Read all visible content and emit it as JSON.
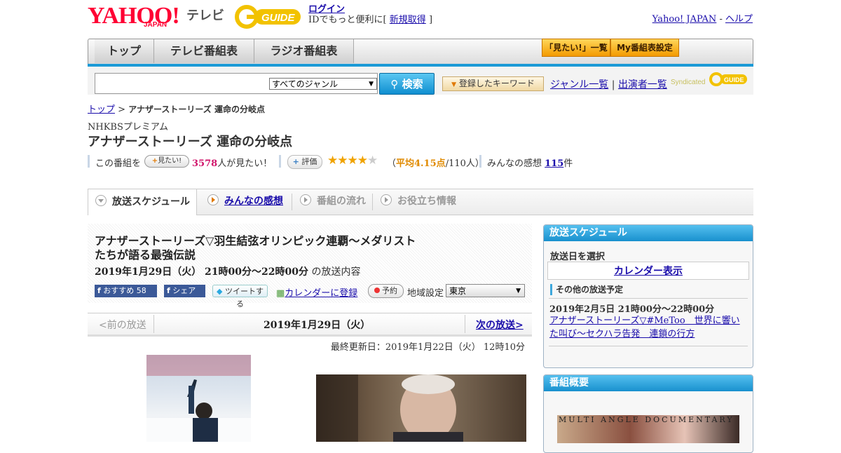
{
  "header": {
    "logo_text": "YAHOO!",
    "logo_sub": "JAPAN",
    "logo_tv": "テレビ",
    "gguide_logo": "GUIDE",
    "login_label": "ログイン",
    "login_sub_prefix": "IDでもっと便利に[",
    "register_label": "新規取得",
    "login_sub_suffix": "]",
    "yahoo_japan_link": "Yahoo! JAPAN",
    "separator": "-",
    "help_link": "ヘルプ"
  },
  "nav": {
    "tabs": [
      "トップ",
      "テレビ番組表",
      "ラジオ番組表"
    ],
    "mitai_list": "「見たい!」一覧",
    "my_schedule": "My番組表設定"
  },
  "search": {
    "genre_selected": "すべてのジャンル",
    "button_label": "検索",
    "keyword_button": "登録したキーワード",
    "genre_list_link": "ジャンル一覧",
    "divider": "|",
    "performer_list_link": "出演者一覧",
    "syndicated": "Syndicated"
  },
  "breadcrumb": {
    "top_link": "トップ",
    "separator": ">",
    "current": "アナザーストーリーズ 運命の分岐点"
  },
  "program": {
    "channel": "NHKBSプレミアム",
    "title": "アナザーストーリーズ 運命の分岐点",
    "watch_prefix": "この番組を",
    "mitai_badge": "見たい!",
    "mitai_count": "3578",
    "mitai_suffix": "人が見たい！",
    "rate_button": "評価",
    "rating": 4.15,
    "rating_stars": "★★★★",
    "rating_star_empty": "★",
    "avg_open": "（",
    "avg_value": "平均4.15点",
    "avg_count": "/110人）",
    "impressions_label": "みんなの感想",
    "impressions_count": "115",
    "impressions_suffix": "件"
  },
  "tabs": {
    "schedule": "放送スケジュール",
    "kanso": "みんなの感想",
    "flow": "番組の流れ",
    "info": "お役立ち情報"
  },
  "episode": {
    "title": "アナザーストーリーズ▽羽生結弦オリンピック連覇～メダリストたちが語る最強伝説",
    "date": "2019年1月29日（火）  21時00分～22時00分",
    "date_suffix": "の放送内容",
    "fb_recommend": "おすすめ",
    "fb_count": "58",
    "fb_share": "シェア",
    "tweet": "ツイートする",
    "calendar_register": "カレンダーに登録",
    "reserve": "予約",
    "region_label": "地域設定",
    "region_value": "東京"
  },
  "pager": {
    "prev": "<前の放送",
    "current": "2019年1月29日（火）",
    "next": "次の放送>"
  },
  "updated": "最終更新日：2019年1月22日（火）  12時10分",
  "sidebar": {
    "schedule_head": "放送スケジュール",
    "select_date": "放送日を選択",
    "calendar_view": "カレンダー表示",
    "other_label": "その他の放送予定",
    "other_date": "2019年2月5日  21時00分～22時00分",
    "other_title": "アナザーストーリーズ▽#MeToo　世界に響いた叫び～セクハラ告発　連鎖の行方",
    "overview_head": "番組概要",
    "promo_text": "MULTI ANGLE DOCUMENTARY"
  },
  "colors": {
    "accent_blue": "#1b9ad6",
    "yahoo_red": "#ff0033",
    "star": "#f0a300",
    "mitai_pink": "#d0146a"
  }
}
